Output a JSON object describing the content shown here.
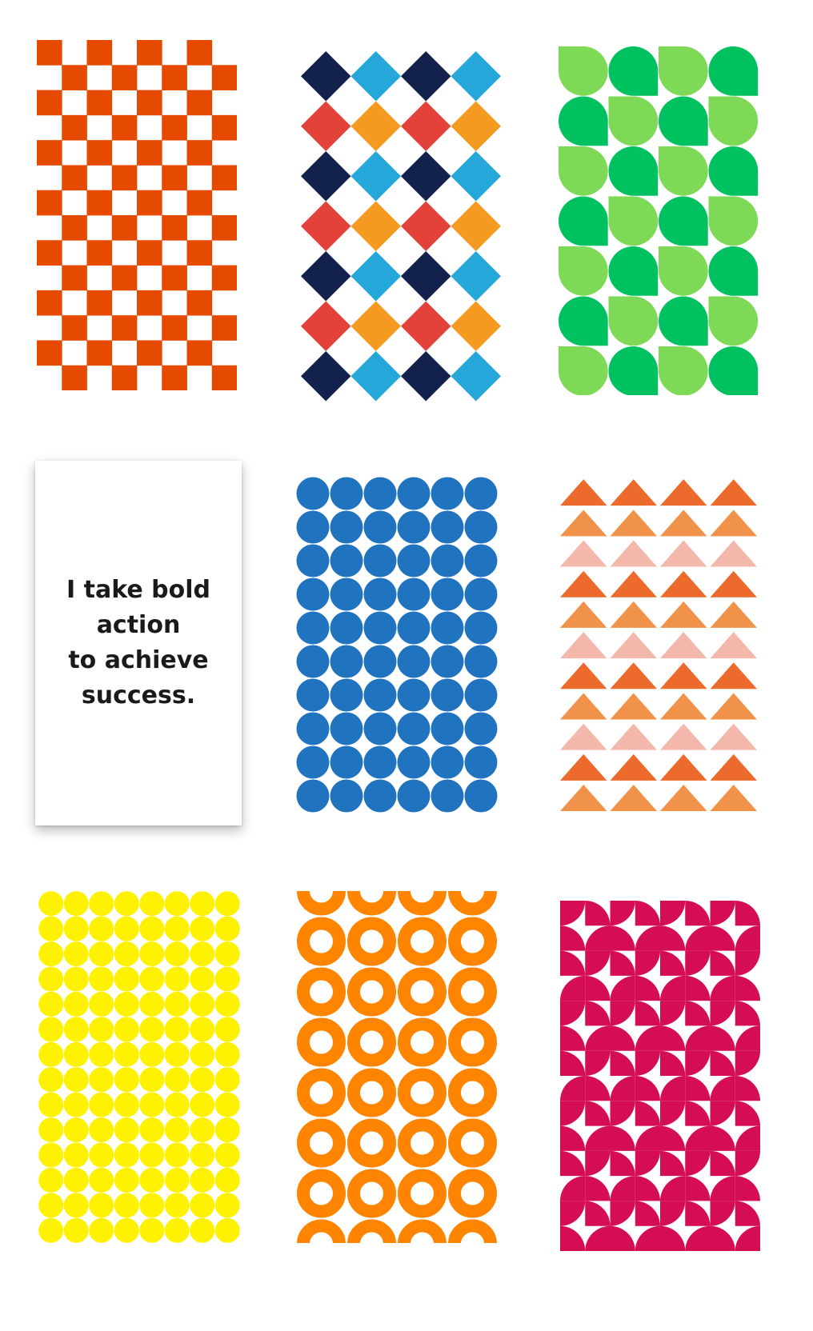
{
  "cards": [
    {
      "pattern": "checkerboard",
      "colors": [
        "#e64a00"
      ]
    },
    {
      "pattern": "diamond-grid",
      "colors": [
        "#13214d",
        "#25a7da",
        "#e3423a",
        "#f49a20"
      ]
    },
    {
      "pattern": "leaf-tiles",
      "colors": [
        "#7ed957",
        "#00c160"
      ]
    },
    {
      "pattern": "affirmation-text",
      "lines": [
        "I take bold",
        "action",
        "to achieve",
        "success."
      ]
    },
    {
      "pattern": "circle-grid",
      "colors": [
        "#1f73bf"
      ]
    },
    {
      "pattern": "triangle-rows",
      "colors": [
        "#ec6a2c",
        "#f0924a",
        "#f4b7ac"
      ]
    },
    {
      "pattern": "dot-grid",
      "colors": [
        "#fff200"
      ]
    },
    {
      "pattern": "ring-grid",
      "colors": [
        "#ff8400"
      ]
    },
    {
      "pattern": "quarter-circle-tiles",
      "colors": [
        "#d40d54"
      ]
    }
  ]
}
